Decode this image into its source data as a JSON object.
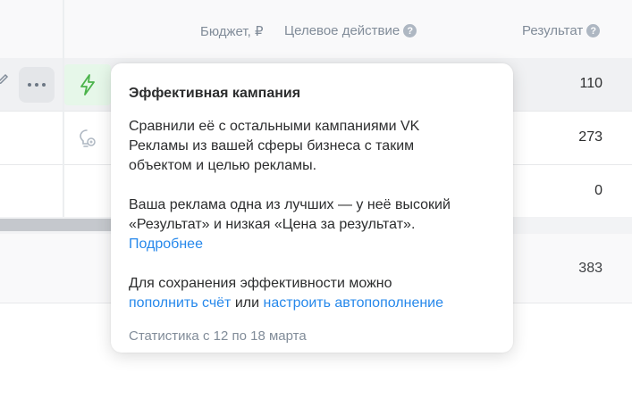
{
  "header": {
    "budget_label": "Бюджет, ₽",
    "target_action_label": "Целевое действие",
    "result_label": "Результат"
  },
  "rows": [
    {
      "result": "110"
    },
    {
      "result": "273"
    },
    {
      "result": "0"
    }
  ],
  "total": {
    "result": "383"
  },
  "tooltip": {
    "title": "Эффективная кампания",
    "p1_lines": [
      "Сравнили её с остальными кампаниями VK",
      "Рекламы из вашей сферы бизнеса с таким",
      "объектом и целью рекламы."
    ],
    "p2_lines": [
      "Ваша реклама одна из лучших — у неё высокий",
      "«Результат» и низкая «Цена за результат»."
    ],
    "more_link": "Подробнее",
    "p3_line1": "Для сохранения эффективности можно",
    "topup_link": "пополнить счёт",
    "or_text": "или",
    "autotopup_link": "настроить автопополнение",
    "footer": "Статистика с 12 по 18 марта"
  },
  "icons": {
    "help": "question-circle-icon",
    "more": "more-horizontal-icon",
    "bolt": "lightning-icon",
    "bulb": "lightbulb-icon",
    "pen": "pencil-icon"
  },
  "colors": {
    "link": "#2688eb",
    "effective_bg": "#e6f7e9",
    "effective_icon": "#4bb34b",
    "muted_text": "#818c99"
  }
}
